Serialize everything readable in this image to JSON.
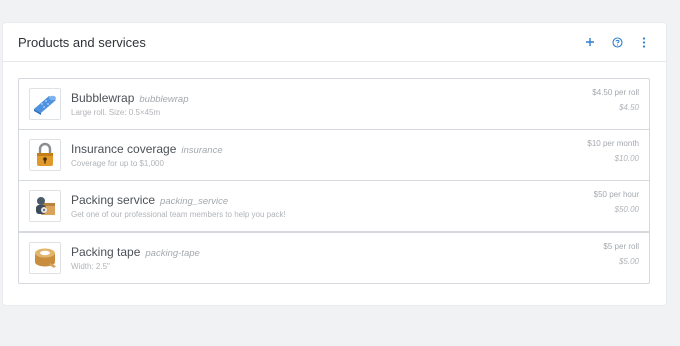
{
  "panel": {
    "title": "Products and services",
    "actions": [
      {
        "name": "add-icon",
        "glyph": "+"
      },
      {
        "name": "help-icon",
        "glyph": "?"
      },
      {
        "name": "more-icon",
        "glyph": "⋮"
      }
    ],
    "accent": "#2f7fd1"
  },
  "items": [
    {
      "icon": "bubblewrap-icon",
      "name": "Bubblewrap",
      "code": "bubblewrap",
      "description": "Large roll. Size: 0.5×45m",
      "unit_price": "$4.50 per roll",
      "total": "$4.50"
    },
    {
      "icon": "padlock-icon",
      "name": "Insurance coverage",
      "code": "insurance",
      "description": "Coverage for up to $1,000",
      "unit_price": "$10 per month",
      "total": "$10.00"
    },
    {
      "icon": "packing-service-icon",
      "name": "Packing service",
      "code": "packing_service",
      "description": "Get one of our professional team members to help you pack!",
      "unit_price": "$50 per hour",
      "total": "$50.00"
    },
    {
      "icon": "packing-tape-icon",
      "name": "Packing tape",
      "code": "packing-tape",
      "description": "Width: 2.5\"",
      "unit_price": "$5 per roll",
      "total": "$5.00"
    }
  ]
}
